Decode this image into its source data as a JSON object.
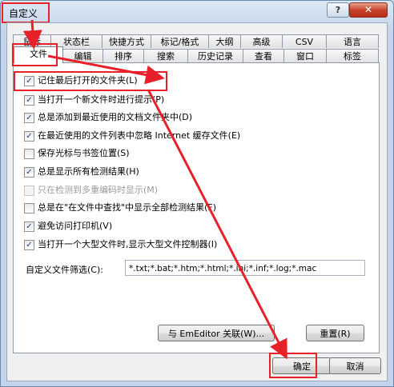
{
  "window": {
    "title": "自定义",
    "help_label": "?",
    "close_label": "✕"
  },
  "tabs_row1": [
    "鼠标",
    "状态栏",
    "快捷方式",
    "标记/格式",
    "大纲",
    "高级",
    "CSV",
    "语言"
  ],
  "tabs_row2": [
    "文件",
    "编辑",
    "排序",
    "搜索",
    "历史记录",
    "查看",
    "窗口",
    "标签"
  ],
  "active_tab": "文件",
  "options": [
    {
      "label": "记住最后打开的文件夹(L)",
      "checked": true,
      "enabled": true
    },
    {
      "label": "当打开一个新文件时进行提示(P)",
      "checked": true,
      "enabled": true
    },
    {
      "label": "总是添加到最近使用的文档文件夹中(D)",
      "checked": true,
      "enabled": true
    },
    {
      "label": "在最近使用的文件列表中忽略 Internet 缓存文件(E)",
      "checked": true,
      "enabled": true
    },
    {
      "label": "保存光标与书签位置(S)",
      "checked": false,
      "enabled": true
    },
    {
      "label": "总是显示所有检测结果(H)",
      "checked": true,
      "enabled": true
    },
    {
      "label": "只在检测到多重编码时显示(M)",
      "checked": false,
      "enabled": false
    },
    {
      "label": "总是在\"在文件中查找\"中显示全部检测结果(F)",
      "checked": false,
      "enabled": true
    },
    {
      "label": "避免访问打印机(V)",
      "checked": true,
      "enabled": true
    },
    {
      "label": "当打开一个大型文件时,显示大型文件控制器(I)",
      "checked": true,
      "enabled": true
    }
  ],
  "filter": {
    "label": "自定义文件筛选(C):",
    "value": "*.txt;*.bat;*.htm;*.html;*.ini;*.inf;*.log;*.mac"
  },
  "buttons": {
    "associate": "与 EmEditor 关联(W)...",
    "reset": "重置(R)",
    "ok": "确定",
    "cancel": "取消"
  },
  "colors": {
    "annotation_red": "#e8202a",
    "window_frame": "#c3d4ea"
  }
}
